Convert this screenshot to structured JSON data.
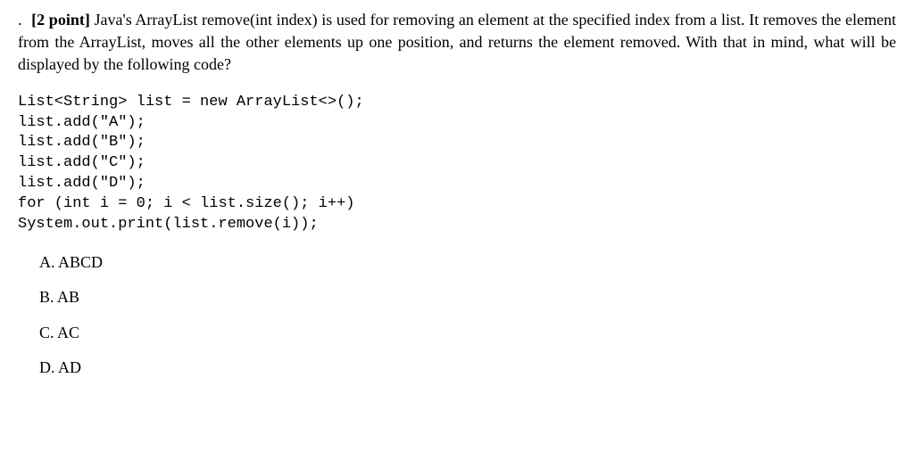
{
  "question": {
    "lead_period": ".",
    "points_label": "[2 point]",
    "prompt": "Java's ArrayList remove(int index) is used for removing an element at the specified index from a list. It removes the element from the ArrayList, moves all the other elements up one position, and returns the element removed. With that in mind, what will be displayed by the following code?"
  },
  "code": {
    "line1_a": "List<String> list = ",
    "line1_new": "new",
    "line1_b": " ArrayList<>();",
    "line2": "list.add(\"A\");",
    "line3": "list.add(\"B\");",
    "line4": "list.add(\"C\");",
    "line5": "list.add(\"D\");",
    "line6_for": "for",
    "line6_a": " (",
    "line6_int": "int",
    "line6_b": " i = 0; i < list.size(); i++)",
    "line7": "System.out.print(list.remove(i));"
  },
  "options": {
    "a": "A. ABCD",
    "b": "B. AB",
    "c": "C. AC",
    "d": "D. AD"
  }
}
